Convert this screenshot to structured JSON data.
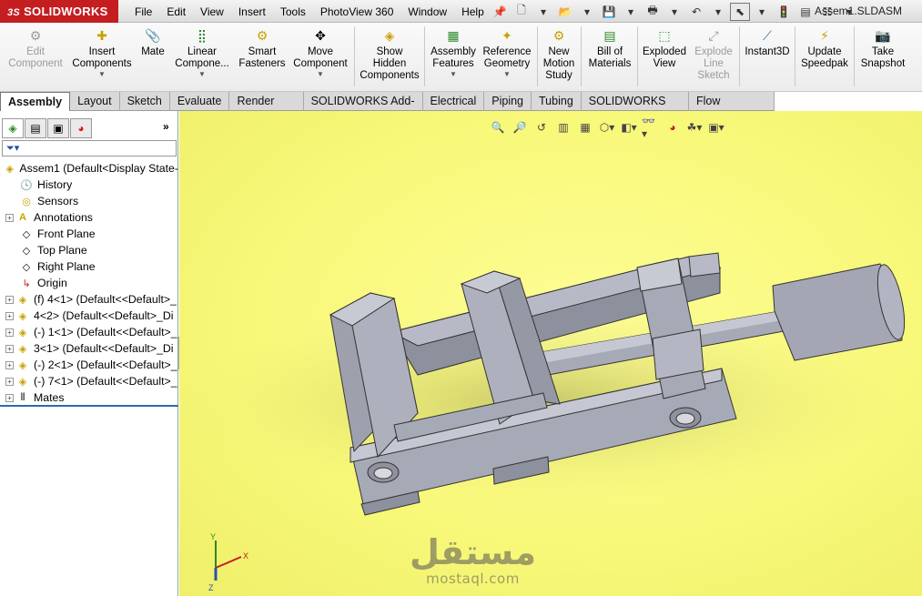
{
  "app": {
    "brand": "SOLIDWORKS",
    "brand_prefix": "3S",
    "document_title": "Assem1.SLDASM"
  },
  "menu": [
    "File",
    "Edit",
    "View",
    "Insert",
    "Tools",
    "PhotoView 360",
    "Window",
    "Help"
  ],
  "ribbon": {
    "edit_component": "Edit Component",
    "insert_components": "Insert Components",
    "mate": "Mate",
    "linear_component": "Linear Compone...",
    "smart_fasteners": "Smart Fasteners",
    "move_component": "Move Component",
    "show_hidden": "Show Hidden Components",
    "assembly_features": "Assembly Features",
    "reference_geometry": "Reference Geometry",
    "new_motion_study": "New Motion Study",
    "bill_of_materials": "Bill of Materials",
    "exploded_view": "Exploded View",
    "explode_line_sketch": "Explode Line Sketch",
    "instant3d": "Instant3D",
    "update_speedpak": "Update Speedpak",
    "take_snapshot": "Take Snapshot"
  },
  "tabs": [
    "Assembly",
    "Layout",
    "Sketch",
    "Evaluate",
    "Render Tools",
    "SOLIDWORKS Add-Ins",
    "Electrical",
    "Piping",
    "Tubing",
    "SOLIDWORKS MBD",
    "Flow Simulation"
  ],
  "tree": {
    "root": "Assem1  (Default<Display State-",
    "items": [
      "History",
      "Sensors",
      "Annotations",
      "Front Plane",
      "Top Plane",
      "Right Plane",
      "Origin"
    ],
    "components": [
      "(f) 4<1> (Default<<Default>_",
      "4<2> (Default<<Default>_Di",
      "(-) 1<1> (Default<<Default>_",
      "3<1> (Default<<Default>_Di",
      "(-) 2<1> (Default<<Default>_",
      "(-) 7<1> (Default<<Default>_"
    ],
    "mates": "Mates"
  },
  "triad": {
    "x": "X",
    "y": "Y",
    "z": "Z"
  },
  "watermark": {
    "arabic": "مستقل",
    "latin": "mostaql.com"
  },
  "colors": {
    "viewport_bg": "#f8f87a",
    "model": "#a6a9b6",
    "brand": "#c41e21"
  }
}
